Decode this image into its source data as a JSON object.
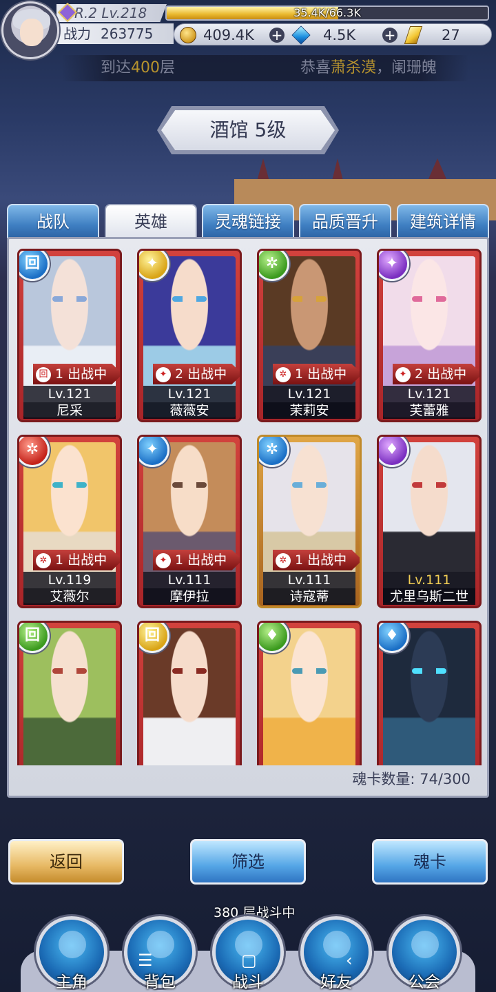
{
  "player": {
    "rank_level": "R.2 Lv.218",
    "exp_text": "35.4K/66.3K",
    "exp_fraction": 0.534,
    "power_label": "战力",
    "power_value": "263775"
  },
  "resources": {
    "gold": "409.4K",
    "diamond": "4.5K",
    "crystal": "27",
    "plus": "+"
  },
  "marquee": {
    "left_prefix": "到达",
    "left_highlight": "400",
    "left_suffix": "层",
    "right_prefix": "恭喜",
    "right_highlight": "萧杀漠",
    "right_suffix": "，阑珊魄"
  },
  "title": "酒馆 5级",
  "tabs": [
    {
      "label": "战队",
      "active": false
    },
    {
      "label": "英雄",
      "active": true
    },
    {
      "label": "灵魂链接",
      "active": false
    },
    {
      "label": "品质晋升",
      "active": false
    },
    {
      "label": "建筑详情",
      "active": false
    }
  ],
  "heroes": [
    {
      "name": "尼采",
      "level": "Lv.121",
      "deploy": "出战中",
      "num": "1",
      "elem": "blue",
      "elem_glyph": "回",
      "max": false,
      "gold": false,
      "skin": "#f4e1d8",
      "hair": "#b9c7dc",
      "cloth": "#e9eef5",
      "eye": "#8aa8d8"
    },
    {
      "name": "薇薇安",
      "level": "Lv.121",
      "deploy": "出战中",
      "num": "2",
      "elem": "yellow",
      "elem_glyph": "✦",
      "max": false,
      "gold": false,
      "skin": "#f6dccb",
      "hair": "#3b3a9a",
      "cloth": "#9ccbe6",
      "eye": "#4fa7e0"
    },
    {
      "name": "茉莉安",
      "level": "Lv.121",
      "deploy": "出战中",
      "num": "1",
      "elem": "green",
      "elem_glyph": "✲",
      "max": false,
      "gold": false,
      "skin": "#c99774",
      "hair": "#5a3a24",
      "cloth": "#3a3f58",
      "eye": "#d7a23a"
    },
    {
      "name": "芙蕾雅",
      "level": "Lv.121",
      "deploy": "出战中",
      "num": "2",
      "elem": "purple",
      "elem_glyph": "✦",
      "max": false,
      "gold": false,
      "skin": "#fbe6e6",
      "hair": "#f1dcea",
      "cloth": "#c7a3d9",
      "eye": "#e06a9a"
    },
    {
      "name": "艾薇尔",
      "level": "Lv.119",
      "deploy": "出战中",
      "num": "1",
      "elem": "red",
      "elem_glyph": "✲",
      "max": false,
      "gold": false,
      "skin": "#fbe2cf",
      "hair": "#f1c56a",
      "cloth": "#e8d9c2",
      "eye": "#3fb2c8"
    },
    {
      "name": "摩伊拉",
      "level": "Lv.111",
      "deploy": "出战中",
      "num": "1",
      "elem": "blue",
      "elem_glyph": "✦",
      "max": false,
      "gold": false,
      "skin": "#f7ddc8",
      "hair": "#c48c5a",
      "cloth": "#6b5a6e",
      "eye": "#6b4a3a"
    },
    {
      "name": "诗寇蒂",
      "level": "Lv.111",
      "deploy": "出战中",
      "num": "1",
      "elem": "blue",
      "elem_glyph": "✲",
      "max": false,
      "gold": true,
      "skin": "#f7e1d2",
      "hair": "#e6e3ea",
      "cloth": "#d8c9a6",
      "eye": "#6aaed8"
    },
    {
      "name": "尤里乌斯二世",
      "level": "Lv.111",
      "deploy": "",
      "num": "",
      "elem": "purple",
      "elem_glyph": "♦",
      "max": true,
      "gold": false,
      "skin": "#f5dccc",
      "hair": "#e4e6ee",
      "cloth": "#2a2a33",
      "eye": "#c23a3a"
    },
    {
      "name": "",
      "level": "",
      "deploy": "",
      "num": "",
      "elem": "green",
      "elem_glyph": "回",
      "max": false,
      "gold": false,
      "skin": "#f6e0cf",
      "hair": "#9dbf5e",
      "cloth": "#4c6a3a",
      "eye": "#b0463a"
    },
    {
      "name": "",
      "level": "",
      "deploy": "",
      "num": "",
      "elem": "yellow",
      "elem_glyph": "回",
      "max": false,
      "gold": false,
      "skin": "#f6dccb",
      "hair": "#6a3a28",
      "cloth": "#efeff2",
      "eye": "#8a2a22"
    },
    {
      "name": "",
      "level": "",
      "deploy": "",
      "num": "",
      "elem": "green",
      "elem_glyph": "♦",
      "max": false,
      "gold": false,
      "skin": "#fbe4d2",
      "hair": "#f3d28c",
      "cloth": "#f0b34a",
      "eye": "#4a9ab4"
    },
    {
      "name": "",
      "level": "",
      "deploy": "",
      "num": "",
      "elem": "blue",
      "elem_glyph": "♦",
      "max": false,
      "gold": false,
      "skin": "#2c3b55",
      "hair": "#1e2a3d",
      "cloth": "#2f5a7a",
      "eye": "#4fe0ff"
    }
  ],
  "card_count": "魂卡数量: 74/300",
  "buttons": {
    "back": "返回",
    "filter": "筛选",
    "soul_card": "魂卡"
  },
  "floor_status": {
    "floor": "380",
    "suffix": "层战斗中"
  },
  "nav": [
    "主角",
    "背包",
    "战斗",
    "好友",
    "公会"
  ],
  "system_nav": {
    "menu": "☰",
    "home": "▢",
    "back": "‹"
  }
}
